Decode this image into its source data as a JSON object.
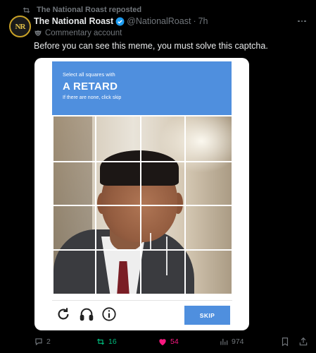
{
  "repost": {
    "text": "The National Roast reposted"
  },
  "author": {
    "avatar_text": "NR",
    "name": "The National Roast",
    "handle": "@NationalRoast",
    "separator": "·",
    "time": "7h",
    "label": "Commentary account"
  },
  "tweet": {
    "text": "Before you can see this meme, you must solve this captcha."
  },
  "captcha": {
    "instruction": "Select all squares with",
    "target": "A RETARD",
    "hint": "If there are none, click skip",
    "skip_label": "SKIP",
    "icons": [
      "refresh-icon",
      "headphones-icon",
      "info-icon"
    ]
  },
  "actions": {
    "replies": "2",
    "reposts": "16",
    "likes": "54",
    "views": "974"
  },
  "colors": {
    "accent_blue": "#4f8fde",
    "repost_green": "#00ba7c",
    "like_pink": "#f91880",
    "verified_blue": "#1d9bf0"
  }
}
